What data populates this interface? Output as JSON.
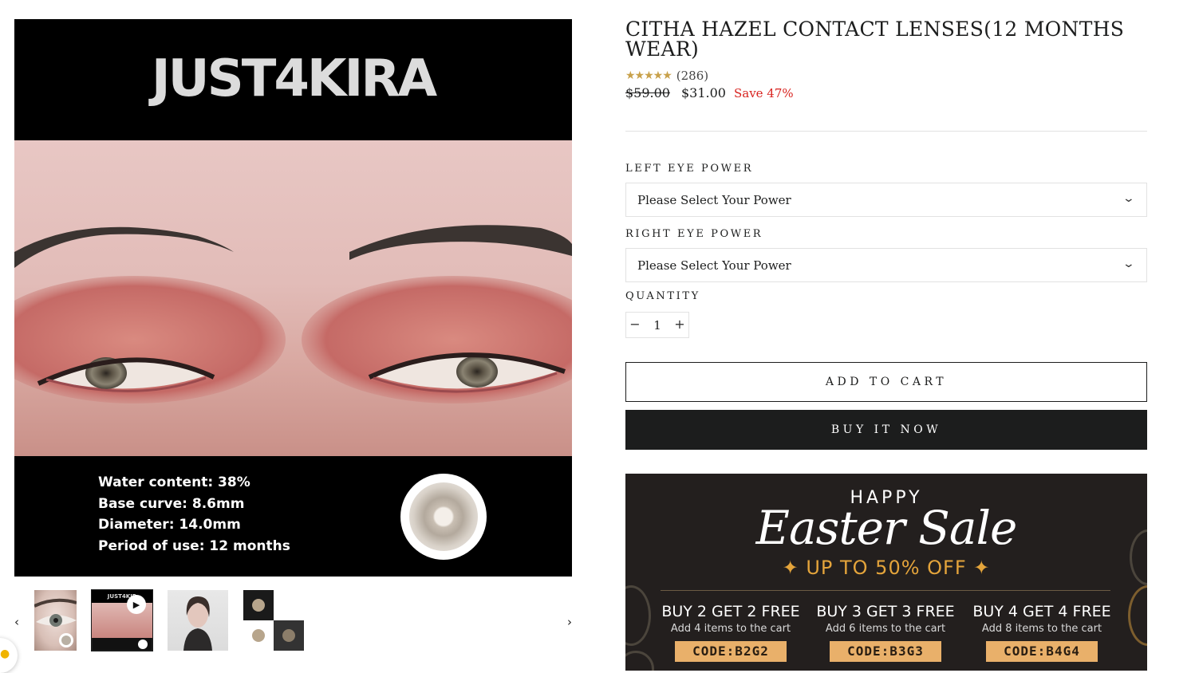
{
  "gallery": {
    "brand": "JUST4KIRA",
    "specs": [
      "Water content: 38%",
      "Base curve: 8.6mm",
      "Diameter: 14.0mm",
      "Period of use: 12 months"
    ],
    "prev_arrow": "‹",
    "next_arrow": "›",
    "thumb2_brand": "JUST4KIR",
    "play_symbol": "▶"
  },
  "product": {
    "title": "CITHA HAZEL CONTACT LENSES(12 MONTHS WEAR)",
    "stars": "★★★★★",
    "rating_count": "(286)",
    "compare_price": "$59.00",
    "price": "$31.00",
    "save": "Save 47%"
  },
  "options": {
    "left_label": "LEFT EYE POWER",
    "left_value": "Please Select Your Power",
    "right_label": "RIGHT EYE POWER",
    "right_value": "Please Select Your Power",
    "quantity_label": "QUANTITY",
    "quantity_value": "1",
    "minus": "−",
    "plus": "+"
  },
  "actions": {
    "add_to_cart": "ADD TO CART",
    "buy_now": "BUY IT NOW"
  },
  "banner": {
    "happy": "HAPPY",
    "sale": "Easter Sale",
    "discount": "✦ UP TO 50% OFF ✦",
    "offers": [
      {
        "title": "BUY 2 GET 2 FREE",
        "sub": "Add 4 items to the cart",
        "code": "CODE:B2G2"
      },
      {
        "title": "BUY 3 GET 3 FREE",
        "sub": "Add 6 items to the cart",
        "code": "CODE:B3G3"
      },
      {
        "title": "BUY 4 GET 4 FREE",
        "sub": "Add 8 items to the cart",
        "code": "CODE:B4G4"
      }
    ]
  },
  "colors": {
    "accent_red": "#d8231f",
    "star_gold": "#c8a14b",
    "button_dark": "#1c1d1d",
    "banner_gold": "#e4a43b"
  }
}
